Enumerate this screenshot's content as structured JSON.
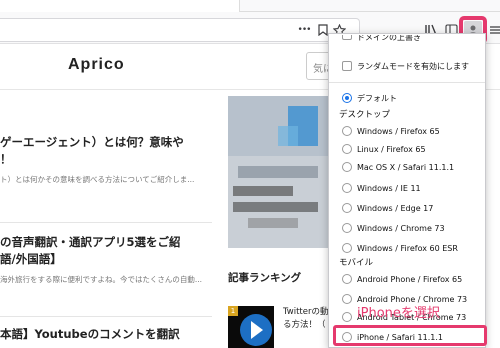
{
  "toolbar": {
    "more_label": "•••",
    "icons": [
      "bookmark-icon",
      "star-icon",
      "library-icon",
      "sidebar-icon",
      "user-agent-switcher-icon",
      "menu-icon"
    ],
    "highlight_color": "#e5396d"
  },
  "site": {
    "logo": "Aprico",
    "search_placeholder": "気に",
    "articles": [
      {
        "title_line1": "ゲーエージェント）とは何？意味や",
        "title_line2": "！",
        "excerpt": "ト）とは何かその意味を調べる方法についてご紹介しま..."
      },
      {
        "title_line1": "の音声翻訳・通訳アプリ5選をご紹",
        "title_line2": "語/外国語】",
        "excerpt": "海外旅行をする際に便利ですよね。今ではたくさんの自動..."
      },
      {
        "title_line1": "本語】Youtubeのコメントを翻訳",
        "title_line2": "",
        "excerpt": ""
      }
    ],
    "ranking_label": "記事ランキング",
    "ranking_badge": "1",
    "ranking_text_line1": "Twitterの動",
    "ranking_text_line2": "る方法！（"
  },
  "menu": {
    "top_cutoff_item": "ドメインの上書き",
    "random_mode_label": "ランダムモードを有効にします",
    "default_label": "デフォルト",
    "desktop_heading": "デスクトップ",
    "desktop_items": [
      "Windows / Firefox 65",
      "Linux / Firefox 65",
      "Mac OS X / Safari 11.1.1",
      "Windows / IE 11",
      "Windows / Edge 17",
      "Windows / Chrome 73",
      "Windows / Firefox 60 ESR"
    ],
    "mobile_heading": "モバイル",
    "mobile_items": [
      "Android Phone / Firefox 65",
      "Android Phone / Chrome 73",
      "Android Tablet / Chrome 73",
      "iPhone / Safari 11.1.1"
    ],
    "selected": "デフォルト"
  },
  "annotation": {
    "text": "iPhoneを選択",
    "color": "#e5396d"
  }
}
